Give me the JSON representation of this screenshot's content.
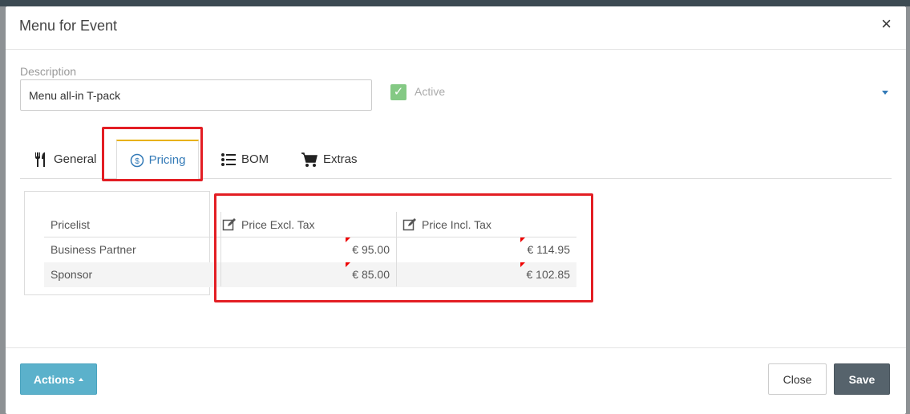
{
  "modal": {
    "title": "Menu for Event",
    "close_glyph": "×"
  },
  "form": {
    "description_label": "Description",
    "description_value": "Menu all-in T-pack",
    "active_label": "Active",
    "active_checked": true
  },
  "tabs": [
    {
      "label": "General",
      "icon": "utensils-icon",
      "active": false
    },
    {
      "label": "Pricing",
      "icon": "dollar-circle-icon",
      "active": true
    },
    {
      "label": "BOM",
      "icon": "list-icon",
      "active": false
    },
    {
      "label": "Extras",
      "icon": "cart-icon",
      "active": false
    }
  ],
  "pricing_table": {
    "headers": [
      "Pricelist",
      "Price Excl. Tax",
      "Price Incl. Tax"
    ],
    "rows": [
      {
        "pricelist": "Business Partner",
        "excl": "€ 95.00",
        "incl": "€ 114.95"
      },
      {
        "pricelist": "Sponsor",
        "excl": "€ 85.00",
        "incl": "€ 102.85"
      }
    ]
  },
  "footer": {
    "actions_label": "Actions",
    "close_label": "Close",
    "save_label": "Save"
  },
  "colors": {
    "highlight": "#e31e24",
    "accent_blue": "#337ab7",
    "actions_button": "#5bb1cb",
    "save_button": "#56636c",
    "active_check": "#5cb85c",
    "tab_top_border": "#e8b10a"
  }
}
